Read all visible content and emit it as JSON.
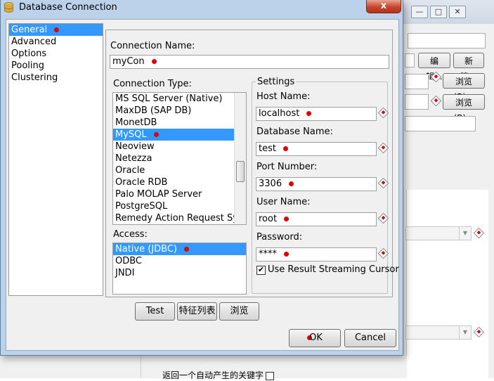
{
  "dialog": {
    "title": "Database Connection",
    "close_label": "x"
  },
  "nav": {
    "items": [
      {
        "label": "General",
        "selected": true
      },
      {
        "label": "Advanced",
        "selected": false
      },
      {
        "label": "Options",
        "selected": false
      },
      {
        "label": "Pooling",
        "selected": false
      },
      {
        "label": "Clustering",
        "selected": false
      }
    ]
  },
  "general": {
    "connection_name_label": "Connection Name:",
    "connection_name_value": "myCon",
    "connection_type_label": "Connection Type:",
    "connection_types": [
      {
        "label": "MS SQL Server (Native)",
        "selected": false
      },
      {
        "label": "MaxDB (SAP DB)",
        "selected": false
      },
      {
        "label": "MonetDB",
        "selected": false
      },
      {
        "label": "MySQL",
        "selected": true
      },
      {
        "label": "Neoview",
        "selected": false
      },
      {
        "label": "Netezza",
        "selected": false
      },
      {
        "label": "Oracle",
        "selected": false
      },
      {
        "label": "Oracle RDB",
        "selected": false
      },
      {
        "label": "Palo MOLAP Server",
        "selected": false
      },
      {
        "label": "PostgreSQL",
        "selected": false
      },
      {
        "label": "Remedy Action Request Syste",
        "selected": false
      }
    ],
    "access_label": "Access:",
    "access_types": [
      {
        "label": "Native (JDBC)",
        "selected": true
      },
      {
        "label": "ODBC",
        "selected": false
      },
      {
        "label": "JNDI",
        "selected": false
      }
    ]
  },
  "settings": {
    "group_label": "Settings",
    "host_name_label": "Host Name:",
    "host_name_value": "localhost",
    "database_name_label": "Database Name:",
    "database_name_value": "test",
    "port_number_label": "Port Number:",
    "port_number_value": "3306",
    "user_name_label": "User Name:",
    "user_name_value": "root",
    "password_label": "Password:",
    "password_value": "****",
    "streaming_cursor_label": "Use Result Streaming Cursor",
    "streaming_cursor_checked": true
  },
  "buttons": {
    "test": "Test",
    "features": "特征列表",
    "explore": "浏览",
    "ok": "OK",
    "cancel": "Cancel"
  },
  "background": {
    "edit_button": "编辑...",
    "new_button": "新建...",
    "browse_button_1": "浏览(B)...",
    "browse_button_2": "浏览(B)...",
    "bottom_text": "返回一个自动产生的关键字",
    "window_controls": [
      "—",
      "□",
      "✕"
    ]
  },
  "colors": {
    "selection": "#3399ff",
    "marker": "#e00000",
    "titlebar": "#bcd2ea",
    "close_button": "#c7452e"
  }
}
